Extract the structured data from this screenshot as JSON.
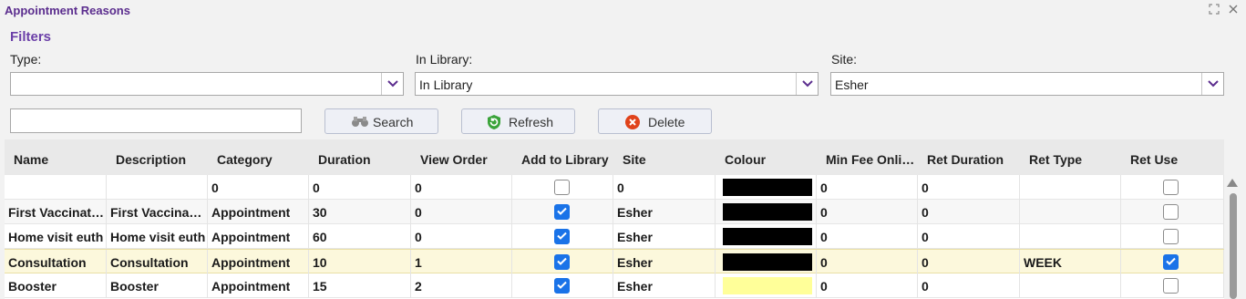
{
  "window": {
    "title": "Appointment Reasons"
  },
  "filters": {
    "heading": "Filters",
    "type": {
      "label": "Type:",
      "value": ""
    },
    "in_library": {
      "label": "In Library:",
      "value": "In Library"
    },
    "site": {
      "label": "Site:",
      "value": "Esher"
    },
    "search_text": ""
  },
  "buttons": {
    "search": "Search",
    "refresh": "Refresh",
    "delete": "Delete"
  },
  "grid": {
    "columns": [
      "Name",
      "Description",
      "Category",
      "Duration",
      "View Order",
      "Add to Library",
      "Site",
      "Colour",
      "Min Fee Onlin...",
      "Ret Duration",
      "Ret Type",
      "Ret Use"
    ],
    "rows": [
      {
        "name": "",
        "description": "",
        "category": "0",
        "duration": "0",
        "view_order": "0",
        "add_to_library": false,
        "site": "0",
        "colour": "#000000",
        "min_fee": "0",
        "ret_duration": "0",
        "ret_type": "",
        "ret_use": false
      },
      {
        "name": "First Vaccinati...",
        "description": "First Vaccinati...",
        "category": "Appointment",
        "duration": "30",
        "view_order": "0",
        "add_to_library": true,
        "site": "Esher",
        "colour": "#000000",
        "min_fee": "0",
        "ret_duration": "0",
        "ret_type": "",
        "ret_use": false
      },
      {
        "name": "Home visit euth",
        "description": "Home visit euth",
        "category": "Appointment",
        "duration": "60",
        "view_order": "0",
        "add_to_library": true,
        "site": "Esher",
        "colour": "#000000",
        "min_fee": "0",
        "ret_duration": "0",
        "ret_type": "",
        "ret_use": false
      },
      {
        "name": "Consultation",
        "description": "Consultation",
        "category": "Appointment",
        "duration": "10",
        "view_order": "1",
        "add_to_library": true,
        "site": "Esher",
        "colour": "#000000",
        "min_fee": "0",
        "ret_duration": "0",
        "ret_type": "WEEK",
        "ret_use": true
      },
      {
        "name": "Booster",
        "description": "Booster",
        "category": "Appointment",
        "duration": "15",
        "view_order": "2",
        "add_to_library": true,
        "site": "Esher",
        "colour": "#ffff99",
        "min_fee": "0",
        "ret_duration": "0",
        "ret_type": "",
        "ret_use": false
      }
    ],
    "selected_row": 3
  },
  "colors": {
    "accent": "#6b3fa8",
    "checkbox_on": "#1a73e8",
    "selected_row": "#fcf8dc"
  },
  "icons": {
    "search": "binoculars-icon",
    "refresh": "refresh-icon",
    "delete": "delete-icon",
    "maximize": "maximize-icon",
    "close": "close-icon"
  }
}
